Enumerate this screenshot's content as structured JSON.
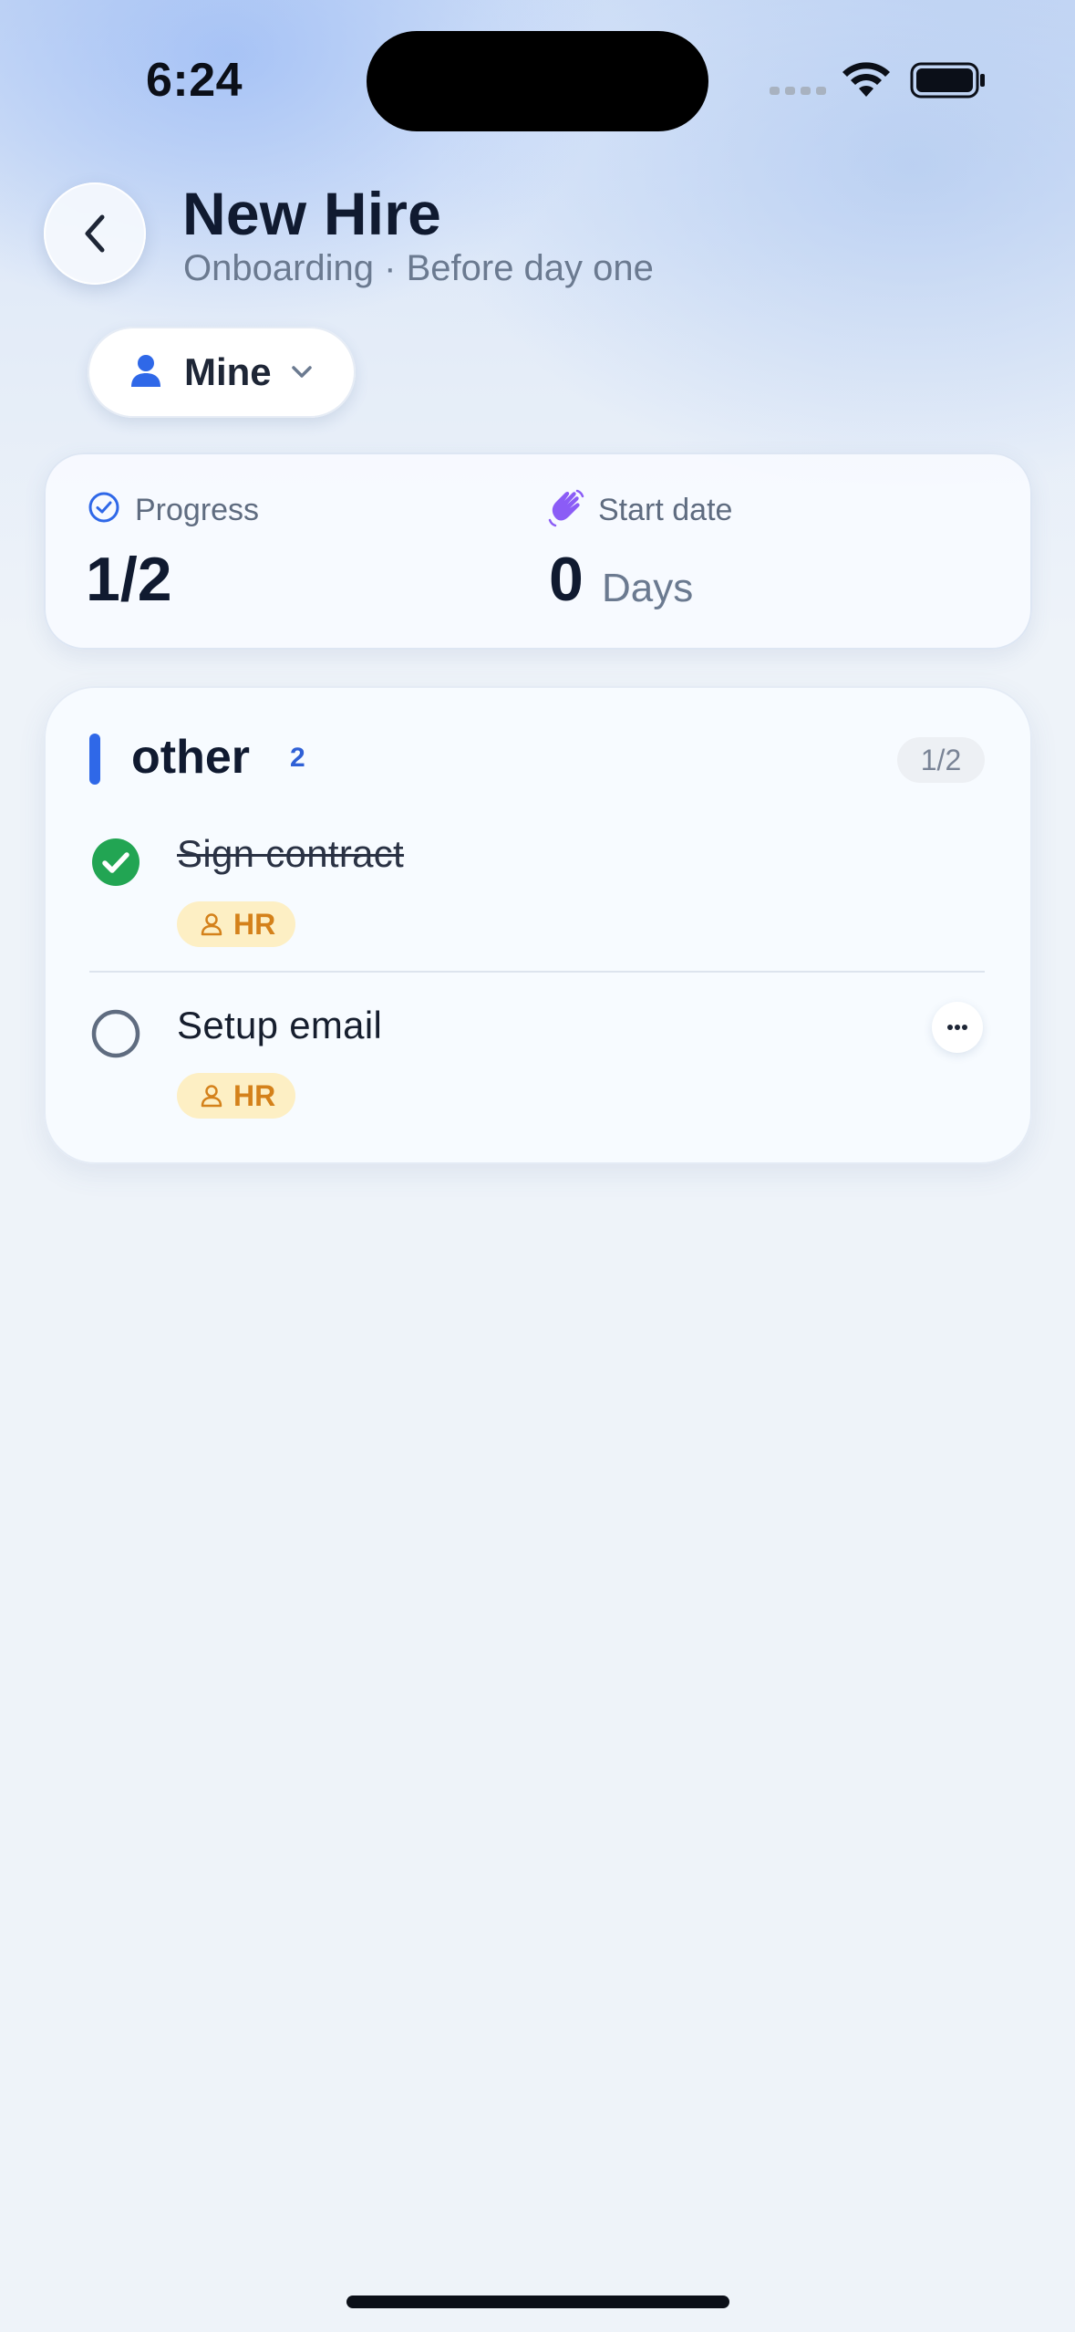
{
  "status_bar": {
    "time": "6:24"
  },
  "header": {
    "title": "New Hire",
    "subtitle": "Onboarding · Before day one",
    "back_icon": "chevron-left-icon"
  },
  "filter": {
    "label": "Mine",
    "icon": "person-icon",
    "chevron": "chevron-down-icon"
  },
  "stats": {
    "progress_label": "Progress",
    "progress_value": "1/2",
    "start_label": "Start date",
    "start_value": "0",
    "start_unit": "Days"
  },
  "task_group": {
    "title": "other",
    "count": "2",
    "progress": "1/2",
    "tasks": [
      {
        "title": "Sign contract",
        "completed": true,
        "tag": "HR"
      },
      {
        "title": "Setup email",
        "completed": false,
        "tag": "HR"
      }
    ]
  },
  "colors": {
    "accent": "#2f68e8",
    "done_green": "#22a553",
    "tag_bg": "#fdefc4",
    "tag_text": "#d4811a",
    "wave_purple": "#8b5cf6"
  }
}
